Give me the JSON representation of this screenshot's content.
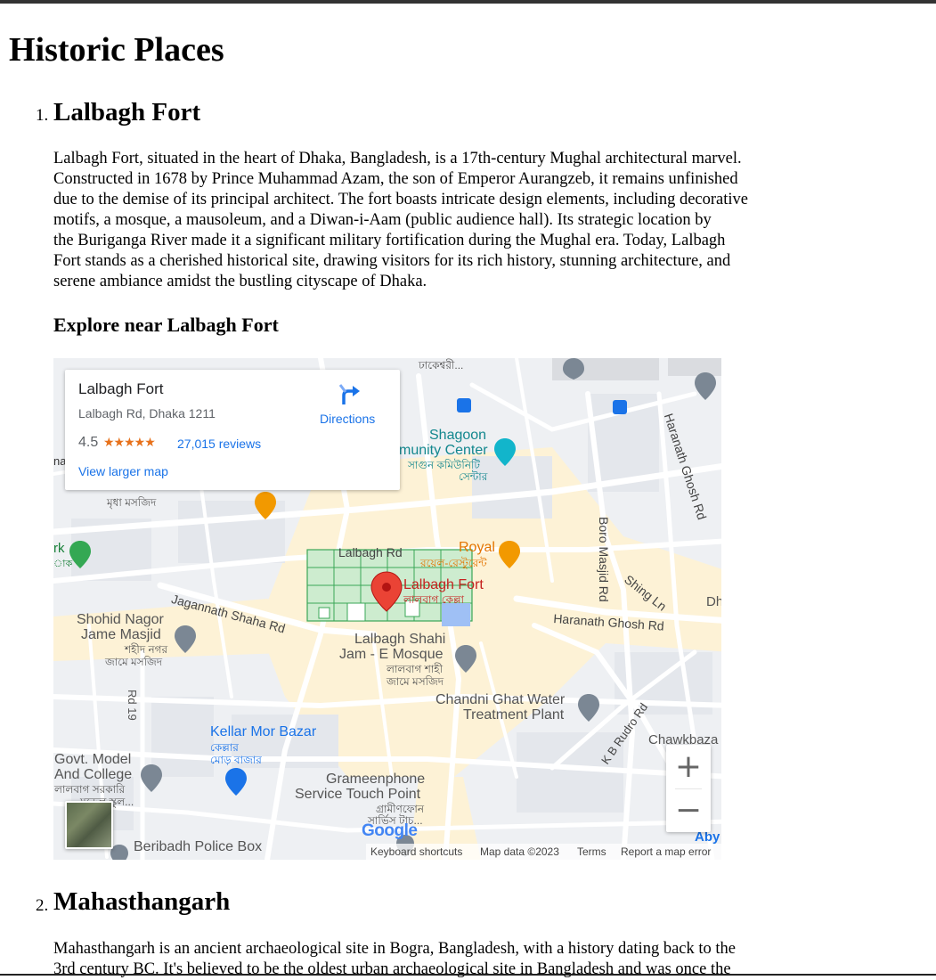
{
  "page": {
    "title": "Historic Places"
  },
  "places": [
    {
      "number": "1.",
      "name": "Lalbagh Fort",
      "description_lines": [
        "Lalbagh Fort, situated in the heart of Dhaka, Bangladesh, is a 17th-century Mughal architectural marvel.",
        "Constructed in 1678 by Prince Muhammad Azam, the son of Emperor Aurangzeb, it remains unfinished",
        "due to the demise of its principal architect. The fort boasts intricate design elements, including decorative",
        "motifs, a mosque, a mausoleum, and a Diwan-i-Aam (public audience hall). Its strategic location by",
        "the Buriganga River made it a significant military fortification during the Mughal era. Today, Lalbagh",
        "Fort stands as a cherished historical site, drawing visitors for its rich history, stunning architecture, and",
        "serene ambiance amidst the bustling cityscape of Dhaka."
      ],
      "explore_heading": "Explore near Lalbagh Fort"
    },
    {
      "number": "2.",
      "name": "Mahasthangarh",
      "description_lines": [
        "Mahasthangarh is an ancient archaeological site in Bogra, Bangladesh, with a history dating back to the",
        "3rd century BC. It's believed to be the oldest urban archaeological site in Bangladesh and was once the"
      ]
    }
  ],
  "map": {
    "card": {
      "title": "Lalbagh Fort",
      "address": "Lalbagh Rd, Dhaka 1211",
      "rating": "4.5",
      "stars": "★★★★★",
      "reviews": "27,015 reviews",
      "larger_map": "View larger map",
      "directions": "Directions"
    },
    "labels": {
      "dhakeshwari": "ঢাকেশ্বরী...",
      "shagoon_1": "Shagoon",
      "shagoon_2": "munity Center",
      "shagoon_bn_1": "সাগুন কমিউনিটি",
      "shagoon_bn_2": "সেন্টার",
      "mosque_bn": "মৃধা মসজিদ",
      "lalbagh_rd": "Lalbagh Rd",
      "royal": "Royal",
      "royal_bn": "রয়েল-রেস্টুরেন্ট",
      "fort_pin": "Lalbagh Fort",
      "fort_pin_bn": "লালবাগ কেল্লা",
      "jagannath": "Jagannath Shaha Rd",
      "shohid_1": "Shohid Nagor",
      "shohid_2": "Jame Masjid",
      "shohid_bn_1": "শহীদ নগর",
      "shohid_bn_2": "জামে মসজিদ",
      "shahi_1": "Lalbagh Shahi",
      "shahi_2": "Jam - E Mosque",
      "shahi_bn_1": "লালবাগ শাহী",
      "shahi_bn_2": "জামে মসজিদ",
      "chandni_1": "Chandni Ghat Water",
      "chandni_2": "Treatment Plant",
      "rd19": "Rd 19",
      "kellar_1": "Kellar Mor Bazar",
      "kellar_bn_1": "কেল্লার",
      "kellar_bn_2": "মোড় বাজার",
      "govt_1": "Govt. Model",
      "govt_2": "And College",
      "govt_bn_1": "লালবাগ সরকারি",
      "govt_bn_2": "মডেল স্কুল...",
      "gp_1": "Grameenphone",
      "gp_2": "Service Touch Point",
      "gp_bn_1": "গ্রামীণফোন",
      "gp_bn_2": "সার্ভিস টাচ...",
      "beribadh": "Beribadh Police Box",
      "haranath_ghosh_v": "Haranath Ghosh Rd",
      "boro_masjid": "Boro Masjid Rd",
      "shing_ln": "Shing Ln",
      "haranath_ghosh_h": "Haranath Ghosh Rd",
      "kb_rudro": "K B Rudro Rd",
      "chawkbazar": "Chawkbaza",
      "dh": "Dh",
      "aby": "Aby",
      "park_bn": "rk",
      "park_bn_2": "াক",
      "na": "na"
    },
    "zoom_in": "+",
    "zoom_out": "−",
    "google": "Google",
    "attribution": {
      "shortcuts": "Keyboard shortcuts",
      "data": "Map data ©2023",
      "terms": "Terms",
      "report": "Report a map error"
    }
  }
}
